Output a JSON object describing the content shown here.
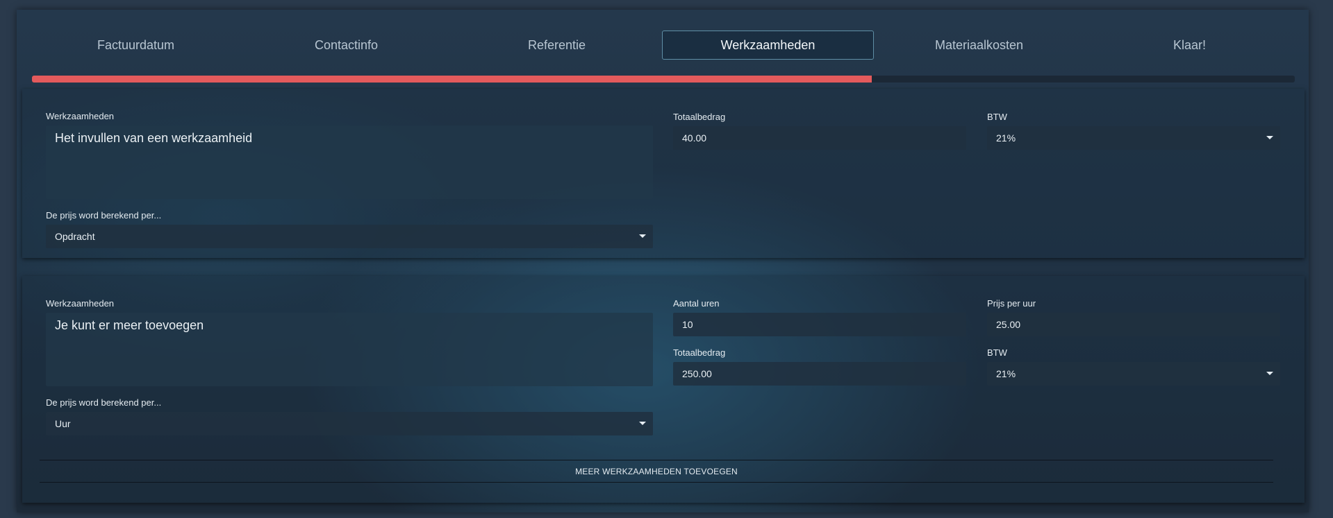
{
  "tabs": [
    {
      "label": "Factuurdatum"
    },
    {
      "label": "Contactinfo"
    },
    {
      "label": "Referentie"
    },
    {
      "label": "Werkzaamheden"
    },
    {
      "label": "Materiaalkosten"
    },
    {
      "label": "Klaar!"
    }
  ],
  "active_tab": "Werkzaamheden",
  "progress": {
    "percent": 66.5
  },
  "colors": {
    "accent": "#e45a5c",
    "active_border": "#5f8fa6"
  },
  "card1": {
    "description_label": "Werkzaamheden",
    "description_value": "Het invullen van een werkzaamheid",
    "pricing_label": "De prijs word berekend per...",
    "pricing_value": "Opdracht",
    "total_label": "Totaalbedrag",
    "total_value": "40.00",
    "vat_label": "BTW",
    "vat_value": "21%"
  },
  "card2": {
    "description_label": "Werkzaamheden",
    "description_value": "Je kunt er meer toevoegen",
    "pricing_label": "De prijs word berekend per...",
    "pricing_value": "Uur",
    "hours_label": "Aantal uren",
    "hours_value": "10",
    "rate_label": "Prijs per uur",
    "rate_value": "25.00",
    "total_label": "Totaalbedrag",
    "total_value": "250.00",
    "vat_label": "BTW",
    "vat_value": "21%"
  },
  "add_button_label": "MEER WERKZAAMHEDEN TOEVOEGEN"
}
